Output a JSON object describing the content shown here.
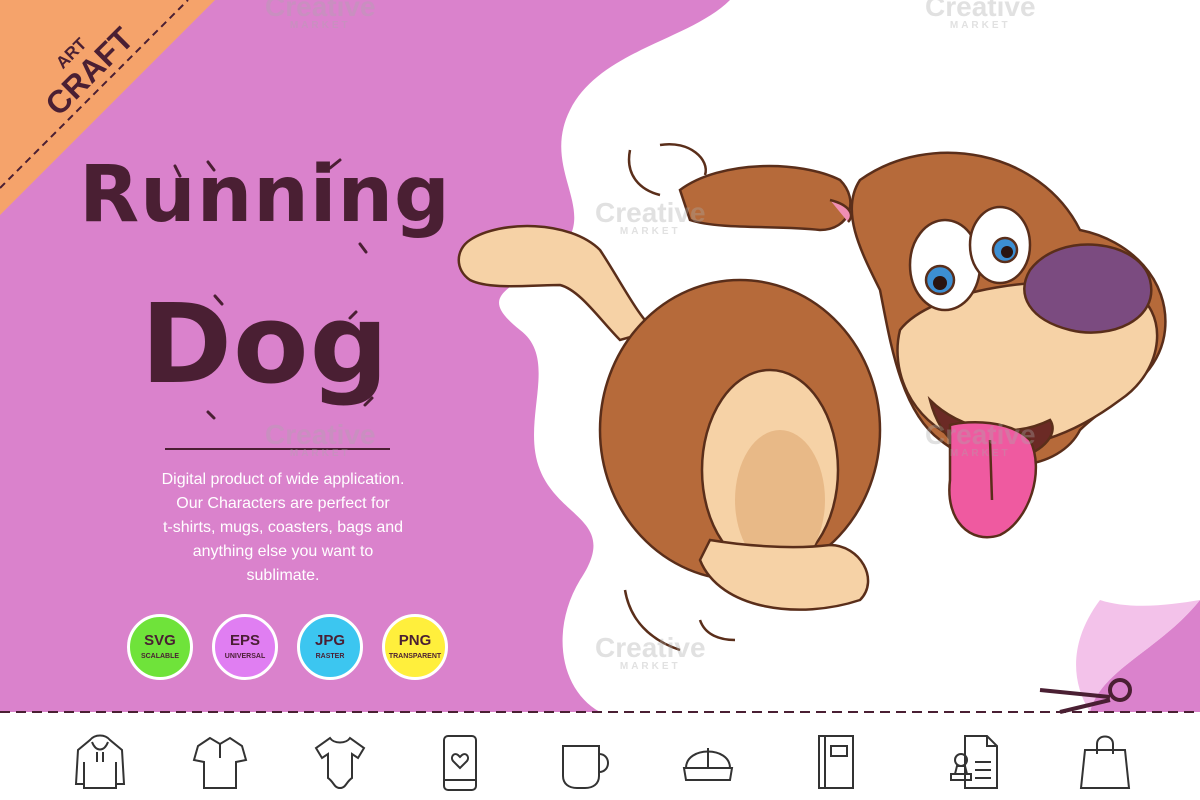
{
  "corner_badge": {
    "line1": "ART",
    "line2": "CRAFT"
  },
  "title": {
    "line1": "Running",
    "line2": "Dog"
  },
  "description": [
    "Digital product of wide application.",
    "Our Characters are perfect for",
    "t-shirts, mugs, coasters, bags and",
    "anything else you want to",
    "sublimate."
  ],
  "formats": [
    {
      "label": "SVG",
      "sub": "SCALABLE",
      "color": "#6fe33a"
    },
    {
      "label": "EPS",
      "sub": "UNIVERSAL",
      "color": "#e07ef2"
    },
    {
      "label": "JPG",
      "sub": "RASTER",
      "color": "#3cc6f0"
    },
    {
      "label": "PNG",
      "sub": "TRANSPARENT",
      "color": "#ffef3c"
    }
  ],
  "watermark": {
    "brand": "Creative",
    "sub": "MARKET"
  },
  "product_icons": [
    "hoodie-icon",
    "polo-shirt-icon",
    "baby-bodysuit-icon",
    "phone-case-icon",
    "mug-icon",
    "cap-icon",
    "notebook-icon",
    "print-stamp-document-icon",
    "shopping-bag-icon"
  ],
  "colors": {
    "panel_pink": "#da82cc",
    "corner_orange": "#f5a36b",
    "text_dark": "#4a1f33",
    "dog_brown": "#b66a3a",
    "dog_cream": "#f6d2a6",
    "nose_purple": "#7b4b80",
    "tongue_pink": "#ef5aa0"
  }
}
